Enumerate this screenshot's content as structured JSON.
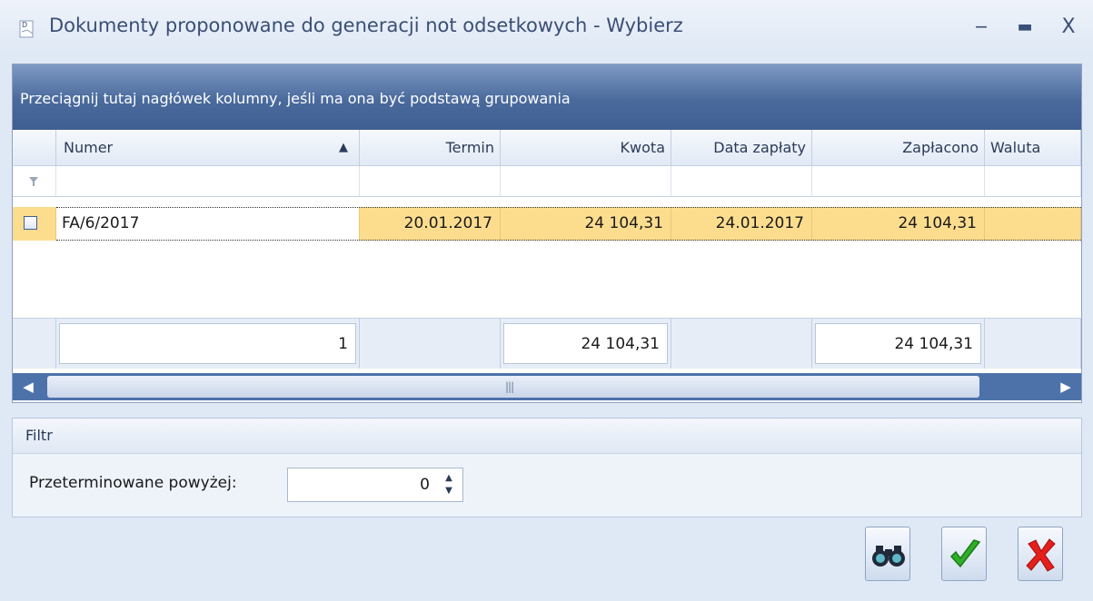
{
  "window": {
    "title": "Dokumenty proponowane do generacji not odsetkowych - Wybierz",
    "minimize_glyph": "‒",
    "maximize_glyph": "▬",
    "close_glyph": "X"
  },
  "grid": {
    "group_panel_text": "Przeciągnij tutaj nagłówek kolumny, jeśli ma ona być podstawą grupowania",
    "sort_glyph": "▲",
    "columns": [
      "Numer",
      "Termin",
      "Kwota",
      "Data zapłaty",
      "Zapłacono",
      "Waluta"
    ],
    "rows": [
      {
        "checked": false,
        "numer": "FA/6/2017",
        "termin": "20.01.2017",
        "kwota": "24 104,31",
        "data_zaplaty": "24.01.2017",
        "zaplacono": "24 104,31",
        "waluta": ""
      }
    ],
    "summary": {
      "count": "1",
      "kwota": "24 104,31",
      "zaplacono": "24 104,31"
    }
  },
  "filter": {
    "title": "Filtr",
    "overdue_label": "Przeterminowane powyżej:",
    "overdue_value": "0"
  },
  "buttons": {
    "search_icon": "binoculars-icon",
    "ok_icon": "checkmark-icon",
    "cancel_icon": "red-x-icon"
  },
  "colors": {
    "selected_row": "#fcdd8e",
    "header_blue": "#4a6a9c",
    "title_text": "#3a4f76"
  }
}
